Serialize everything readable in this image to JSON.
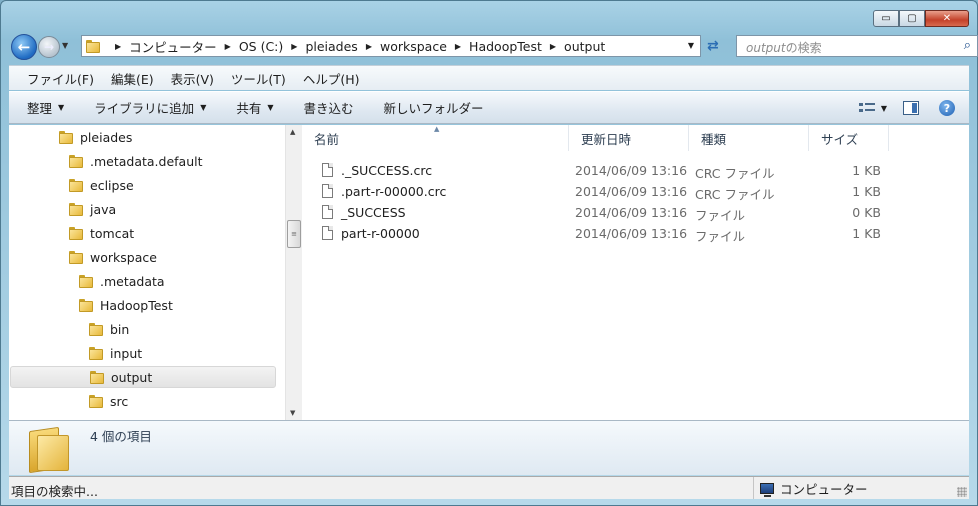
{
  "window": {
    "caption_buttons": {
      "minimize": "▭",
      "maximize": "▢",
      "close": "✕"
    }
  },
  "nav": {
    "breadcrumb": [
      "コンピューター",
      "OS (C:)",
      "pleiades",
      "workspace",
      "HadoopTest",
      "output"
    ],
    "search_placeholder_prefix": "output",
    "search_placeholder_suffix": "の検索"
  },
  "menubar": [
    "ファイル(F)",
    "編集(E)",
    "表示(V)",
    "ツール(T)",
    "ヘルプ(H)"
  ],
  "commands": [
    {
      "label": "整理",
      "dropdown": true
    },
    {
      "label": "ライブラリに追加",
      "dropdown": true
    },
    {
      "label": "共有",
      "dropdown": true
    },
    {
      "label": "書き込む",
      "dropdown": false
    },
    {
      "label": "新しいフォルダー",
      "dropdown": false
    }
  ],
  "tree": [
    {
      "label": "pleiades",
      "level": 0,
      "selected": false
    },
    {
      "label": ".metadata.default",
      "level": 1,
      "selected": false
    },
    {
      "label": "eclipse",
      "level": 1,
      "selected": false
    },
    {
      "label": "java",
      "level": 1,
      "selected": false
    },
    {
      "label": "tomcat",
      "level": 1,
      "selected": false
    },
    {
      "label": "workspace",
      "level": 1,
      "selected": false
    },
    {
      "label": ".metadata",
      "level": 2,
      "selected": false
    },
    {
      "label": "HadoopTest",
      "level": 2,
      "selected": false
    },
    {
      "label": "bin",
      "level": 3,
      "selected": false
    },
    {
      "label": "input",
      "level": 3,
      "selected": false
    },
    {
      "label": "output",
      "level": 3,
      "selected": true
    },
    {
      "label": "src",
      "level": 3,
      "selected": false
    }
  ],
  "columns": {
    "name": "名前",
    "date": "更新日時",
    "type": "種類",
    "size": "サイズ"
  },
  "files": [
    {
      "name": "._SUCCESS.crc",
      "date": "2014/06/09 13:16",
      "type": "CRC ファイル",
      "size": "1 KB"
    },
    {
      "name": ".part-r-00000.crc",
      "date": "2014/06/09 13:16",
      "type": "CRC ファイル",
      "size": "1 KB"
    },
    {
      "name": "_SUCCESS",
      "date": "2014/06/09 13:16",
      "type": "ファイル",
      "size": "0 KB"
    },
    {
      "name": "part-r-00000",
      "date": "2014/06/09 13:16",
      "type": "ファイル",
      "size": "1 KB"
    }
  ],
  "details": {
    "count": "4 個の項目"
  },
  "status": {
    "left": "項目の検索中...",
    "right": "コンピューター"
  }
}
